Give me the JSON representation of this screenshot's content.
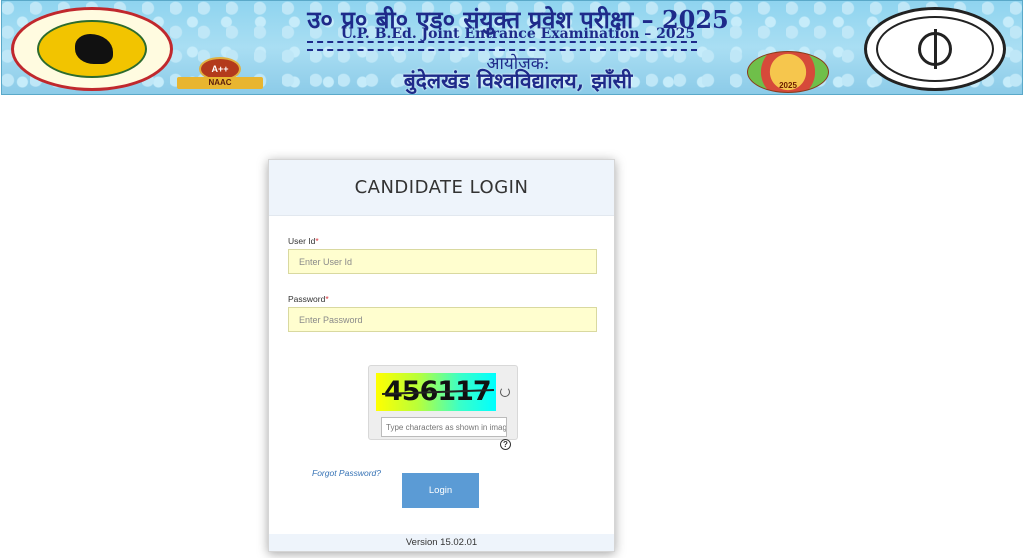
{
  "header": {
    "title_hindi": "उ० प्र० बी० एड० संयुक्त प्रवेश परीक्षा – 2025",
    "title_english": "U.P. B.Ed. Joint Entrance Examination – 2025",
    "organiser_label": "आयोजक:",
    "university_name": "बुंदेलखंड विश्वविद्यालय, झाँसी",
    "naac_grade": "A++",
    "naac_label": "NAAC",
    "badge_year": "2025",
    "left_logo": "bundelkhand-university-emblem",
    "right_logo": "uttar-pradesh-government-emblem"
  },
  "login": {
    "title": "CANDIDATE LOGIN",
    "user_id_label": "User Id",
    "user_id_placeholder": "Enter User Id",
    "password_label": "Password",
    "password_placeholder": "Enter Password",
    "required_marker": "*",
    "captcha_text": "456117",
    "captcha_placeholder": "Type characters as shown in image",
    "help_glyph": "?",
    "forgot_password": "Forgot Password?",
    "login_button": "Login",
    "version": "Version 15.02.01"
  },
  "colors": {
    "title_blue": "#1e2a8a",
    "input_bg": "#fffecf",
    "button_blue": "#5b9bd5",
    "link_blue": "#3572b5",
    "required_red": "#d9363e"
  }
}
